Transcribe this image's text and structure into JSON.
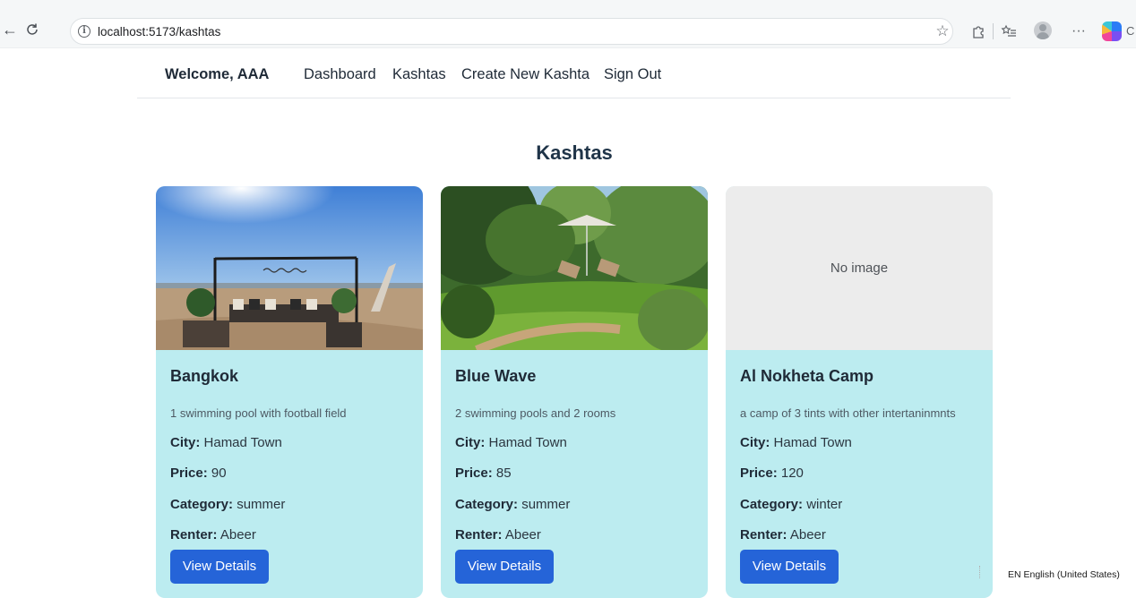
{
  "browser": {
    "url": "localhost:5173/kashtas",
    "copilot_label": "C"
  },
  "nav": {
    "welcome": "Welcome, AAA",
    "links": [
      "Dashboard",
      "Kashtas",
      "Create New Kashta",
      "Sign Out"
    ]
  },
  "page": {
    "title": "Kashtas"
  },
  "labels": {
    "city": "City:",
    "price": "Price:",
    "category": "Category:",
    "renter": "Renter:",
    "no_image": "No image",
    "view_details": "View Details"
  },
  "kashtas": [
    {
      "name": "Bangkok",
      "description": "1 swimming pool with football field",
      "city": "Hamad Town",
      "price": "90",
      "category": "summer",
      "renter": "Abeer",
      "has_image": true
    },
    {
      "name": "Blue Wave",
      "description": "2 swimming pools and 2 rooms",
      "city": "Hamad Town",
      "price": "85",
      "category": "summer",
      "renter": "Abeer",
      "has_image": true
    },
    {
      "name": "Al Nokheta Camp",
      "description": "a camp of 3 tints with other intertaninmnts",
      "city": "Hamad Town",
      "price": "120",
      "category": "winter",
      "renter": "Abeer",
      "has_image": false
    }
  ],
  "taskbar": {
    "language": "EN English (United States)"
  },
  "colors": {
    "card_bg": "#bcecf0",
    "button_bg": "#2564d8",
    "no_image_bg": "#ececec"
  }
}
